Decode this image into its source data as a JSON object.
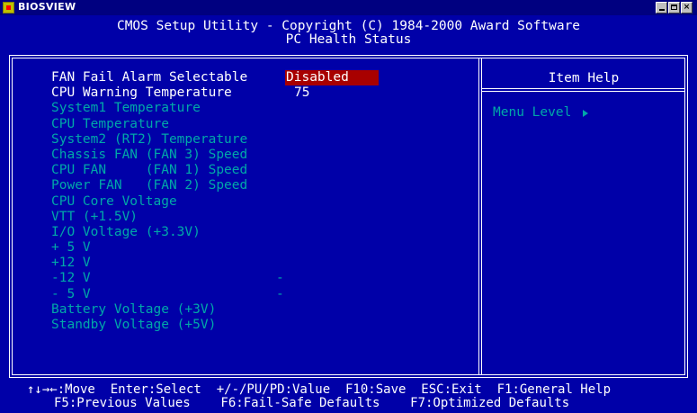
{
  "window": {
    "title": "BIOSVIEW",
    "controls": {
      "minimize": "minimize",
      "maximize": "maximize",
      "close": "×"
    }
  },
  "header": {
    "line1": "CMOS Setup Utility - Copyright (C) 1984-2000 Award Software",
    "line2": "PC Health Status"
  },
  "items": [
    {
      "label": "FAN Fail Alarm Selectable",
      "value": "Disabled",
      "style": "selected"
    },
    {
      "label": "CPU Warning Temperature",
      "value": "75",
      "style": "plain"
    },
    {
      "label": "System1 Temperature",
      "value": ""
    },
    {
      "label": "CPU Temperature",
      "value": ""
    },
    {
      "label": "System2 (RT2) Temperature",
      "value": ""
    },
    {
      "label": "Chassis FAN (FAN 3) Speed",
      "value": ""
    },
    {
      "label": "CPU FAN     (FAN 1) Speed",
      "value": ""
    },
    {
      "label": "Power FAN   (FAN 2) Speed",
      "value": ""
    },
    {
      "label": "CPU Core Voltage",
      "value": ""
    },
    {
      "label": "VTT (+1.5V)",
      "value": ""
    },
    {
      "label": "I/O Voltage (+3.3V)",
      "value": ""
    },
    {
      "label": "+ 5 V",
      "value": ""
    },
    {
      "label": "+12 V",
      "value": ""
    },
    {
      "label": "-12 V",
      "value": "-"
    },
    {
      "label": "- 5 V",
      "value": "-"
    },
    {
      "label": "Battery Voltage (+3V)",
      "value": ""
    },
    {
      "label": "Standby Voltage (+5V)",
      "value": ""
    }
  ],
  "help": {
    "title": "Item Help",
    "menu_level": "Menu Level",
    "menu_level_icon": "right-triangle-icon"
  },
  "footer": {
    "line1": "↑↓→←:Move  Enter:Select  +/-/PU/PD:Value  F10:Save  ESC:Exit  F1:General Help",
    "line2": "F5:Previous Values    F6:Fail-Safe Defaults    F7:Optimized Defaults"
  },
  "colors": {
    "background": "#0000a8",
    "text": "#ffffff",
    "disabled_text": "#00a8a8",
    "highlight": "#a80000"
  }
}
